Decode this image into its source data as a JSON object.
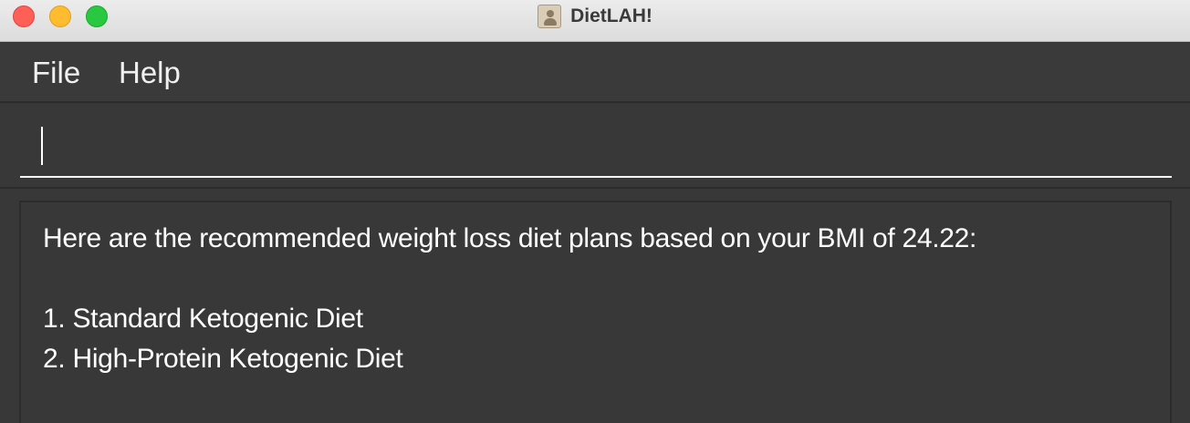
{
  "window": {
    "title": "DietLAH!",
    "app_icon": "contact-card-icon"
  },
  "menu": {
    "items": [
      {
        "label": "File"
      },
      {
        "label": "Help"
      }
    ]
  },
  "command_box": {
    "value": "",
    "placeholder": ""
  },
  "result": {
    "heading": "Here are the recommended weight loss diet plans based on your BMI of 24.22:",
    "plans": [
      "1. Standard Ketogenic Diet",
      "2. High-Protein Ketogenic Diet"
    ]
  },
  "colors": {
    "background": "#383838",
    "text": "#ffffff",
    "traffic_close": "#fe5f57",
    "traffic_minimize": "#febc2e",
    "traffic_maximize": "#28c840"
  }
}
